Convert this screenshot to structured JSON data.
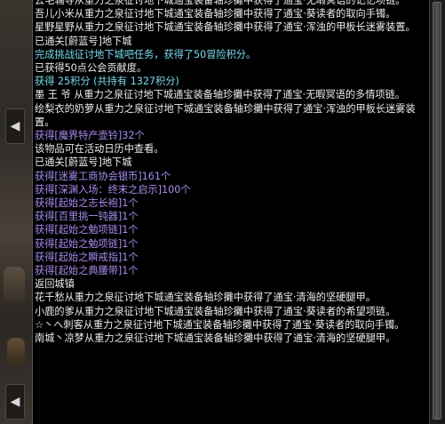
{
  "side_buttons": {
    "top_glyph": "◀",
    "bottom_glyph": "◀"
  },
  "colors": {
    "normal": "#ececec",
    "system": "#7cdcf2",
    "item": "#a88cf0",
    "background": "#000000"
  },
  "chat_log": [
    {
      "text": "去毛辅导从重力之泉征讨地下城通宝装备轴珍攤中获得了通宝·无暇冥语的记忆项链。",
      "style": "w"
    },
    {
      "text": "吾儿小米从重力之泉征讨地下城通宝装备轴珍攤中获得了通宝·葵读者的取向手镯。",
      "style": "w"
    },
    {
      "text": "星野星野从重力之泉征讨地下城通宝装备轴珍攤中获得了通宝·浑浊的甲板长迷雾装置。",
      "style": "w"
    },
    {
      "text": "已通关[蔚蓝号]地下城",
      "style": "w"
    },
    {
      "text": "完成挑战征讨地下城吧任务，获得了50冒险积分。",
      "style": "c"
    },
    {
      "text": "已获得50点公会贡献度。",
      "style": "w"
    },
    {
      "text": "获得 25积分 (共持有 1327积分)",
      "style": "c"
    },
    {
      "text": "墨 王 爷 从重力之泉征讨地下城通宝装备轴珍攤中获得了通宝·无暇冥语的多情项链。",
      "style": "w"
    },
    {
      "text": "绘梨衣的奶萝从重力之泉征讨地下城通宝装备轴珍攤中获得了通宝·浑浊的甲板长迷雾装置。",
      "style": "w"
    },
    {
      "text": "获得[魔界特产壶铃]32个",
      "style": "p"
    },
    {
      "text": "该物品可在活动日历中查看。",
      "style": "w"
    },
    {
      "text": "已通关[蔚蓝号]地下城",
      "style": "w"
    },
    {
      "text": "获得[迷雾工商协会银币]161个",
      "style": "p"
    },
    {
      "text": "获得[深渊入场：终末之启示]100个",
      "style": "p"
    },
    {
      "text": "获得[起始之志长袍]1个",
      "style": "p"
    },
    {
      "text": "获得[百里挑一钝器]1个",
      "style": "p"
    },
    {
      "text": "获得[起始之勉项链]1个",
      "style": "p"
    },
    {
      "text": "获得[起始之勉项链]1个",
      "style": "p"
    },
    {
      "text": "获得[起始之瞬戒指]1个",
      "style": "p"
    },
    {
      "text": "获得[起始之典腰带]1个",
      "style": "p"
    },
    {
      "text": "返回城镇",
      "style": "w"
    },
    {
      "text": "花千愁从重力之泉征讨地下城通宝装备轴珍攤中获得了通宝·清海的坚硬腿甲。",
      "style": "w"
    },
    {
      "text": "小鹿的爹从重力之泉征讨地下城通宝装备轴珍攤中获得了通宝·葵读者的希望项链。",
      "style": "w"
    },
    {
      "text": "☆丶へ刺客从重力之泉征讨地下城通宝装备轴珍攤中获得了通宝·葵读者的取向手镯。",
      "style": "w"
    },
    {
      "text": "南城丶凉梦从重力之泉征讨地下城通宝装备轴珍攤中获得了通宝·清海的坚硬腿甲。",
      "style": "w"
    }
  ]
}
